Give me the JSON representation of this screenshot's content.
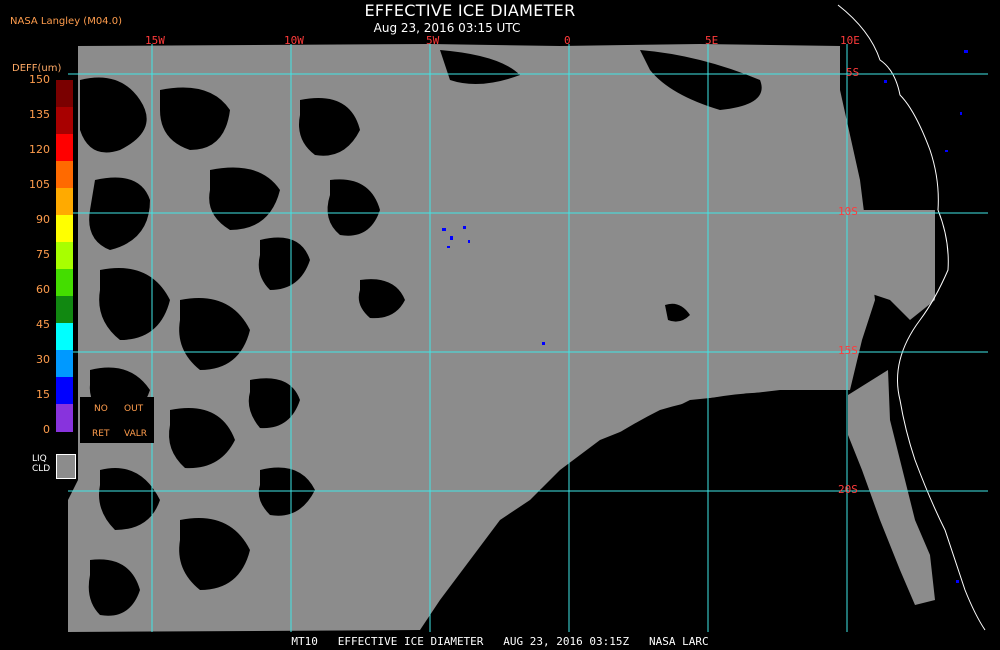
{
  "header": {
    "credit": "NASA Langley (M04.0)",
    "title": "EFFECTIVE ICE DIAMETER",
    "subtitle": "Aug 23, 2016 03:15 UTC"
  },
  "map": {
    "longitude_labels": [
      "15W",
      "10W",
      "5W",
      "0",
      "5E",
      "10E"
    ],
    "latitude_labels": [
      "5S",
      "10S",
      "15S",
      "20S"
    ],
    "colors": {
      "liquid_cloud": "#8c8c8c",
      "clear": "#000000",
      "gridlines": "#3fe6e6",
      "grid_labels": "#ff3b3b",
      "coastline": "#ffffff"
    }
  },
  "legend": {
    "title": "DEFF(um)",
    "ticks": [
      "150",
      "135",
      "120",
      "105",
      "90",
      "75",
      "60",
      "45",
      "30",
      "15",
      "0"
    ],
    "colors": [
      "#7a0000",
      "#a80000",
      "#ff0000",
      "#ff6a00",
      "#ffaa00",
      "#ffff00",
      "#a8ff00",
      "#44dd00",
      "#118811",
      "#00ffff",
      "#0099ff",
      "#0000ff",
      "#8833dd"
    ],
    "no_ret": [
      "NO",
      "RET"
    ],
    "out_valr": [
      "OUT",
      "VALR"
    ],
    "liquid_cloud_label": [
      "LIQ",
      "CLD"
    ]
  },
  "footer": {
    "text": "MT10   EFFECTIVE ICE DIAMETER   AUG 23, 2016 03:15Z   NASA LARC"
  }
}
